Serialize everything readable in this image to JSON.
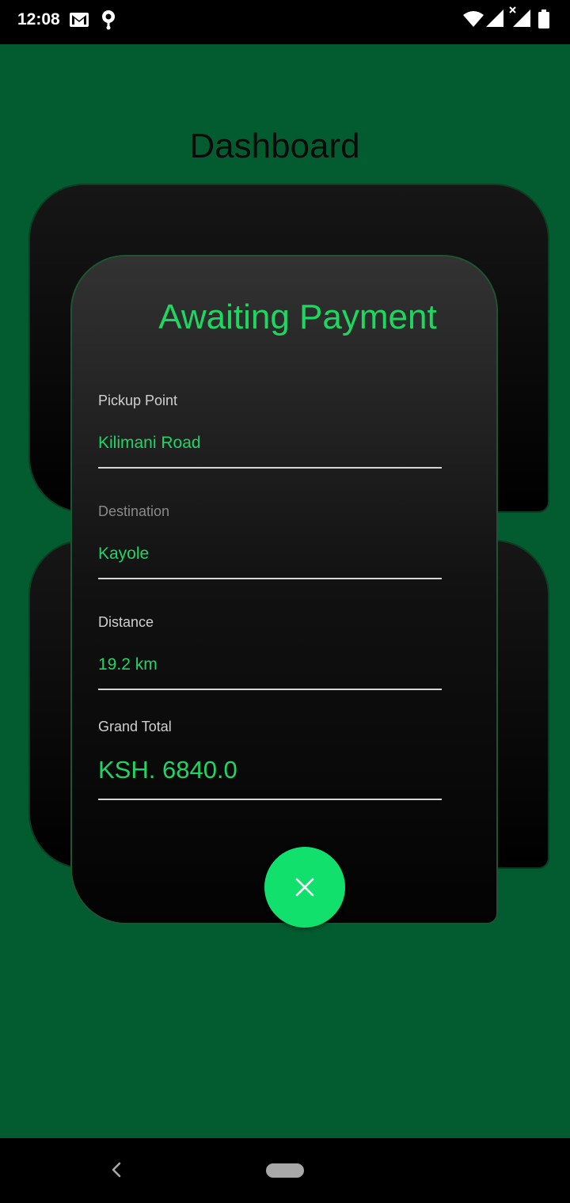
{
  "status_bar": {
    "time": "12:08",
    "icons": [
      "gmail-icon",
      "location-icon",
      "wifi-icon",
      "signal-icon",
      "signal-no-data-icon",
      "battery-icon"
    ]
  },
  "screen": {
    "title": "Dashboard"
  },
  "dialog": {
    "title": "Awaiting Payment",
    "fields": [
      {
        "label": "Pickup Point",
        "value": "Kilimani Road"
      },
      {
        "label": "Destination",
        "value": "Kayole"
      },
      {
        "label": "Distance",
        "value": "19.2 km"
      },
      {
        "label": "Grand Total",
        "value": "KSH. 6840.0"
      }
    ],
    "close_button_icon": "close-icon"
  },
  "colors": {
    "background": "#035c2f",
    "accent": "#12e06d",
    "value_text": "#20d467"
  },
  "nav_bar": {
    "icons": [
      "back-icon",
      "home-pill"
    ]
  }
}
